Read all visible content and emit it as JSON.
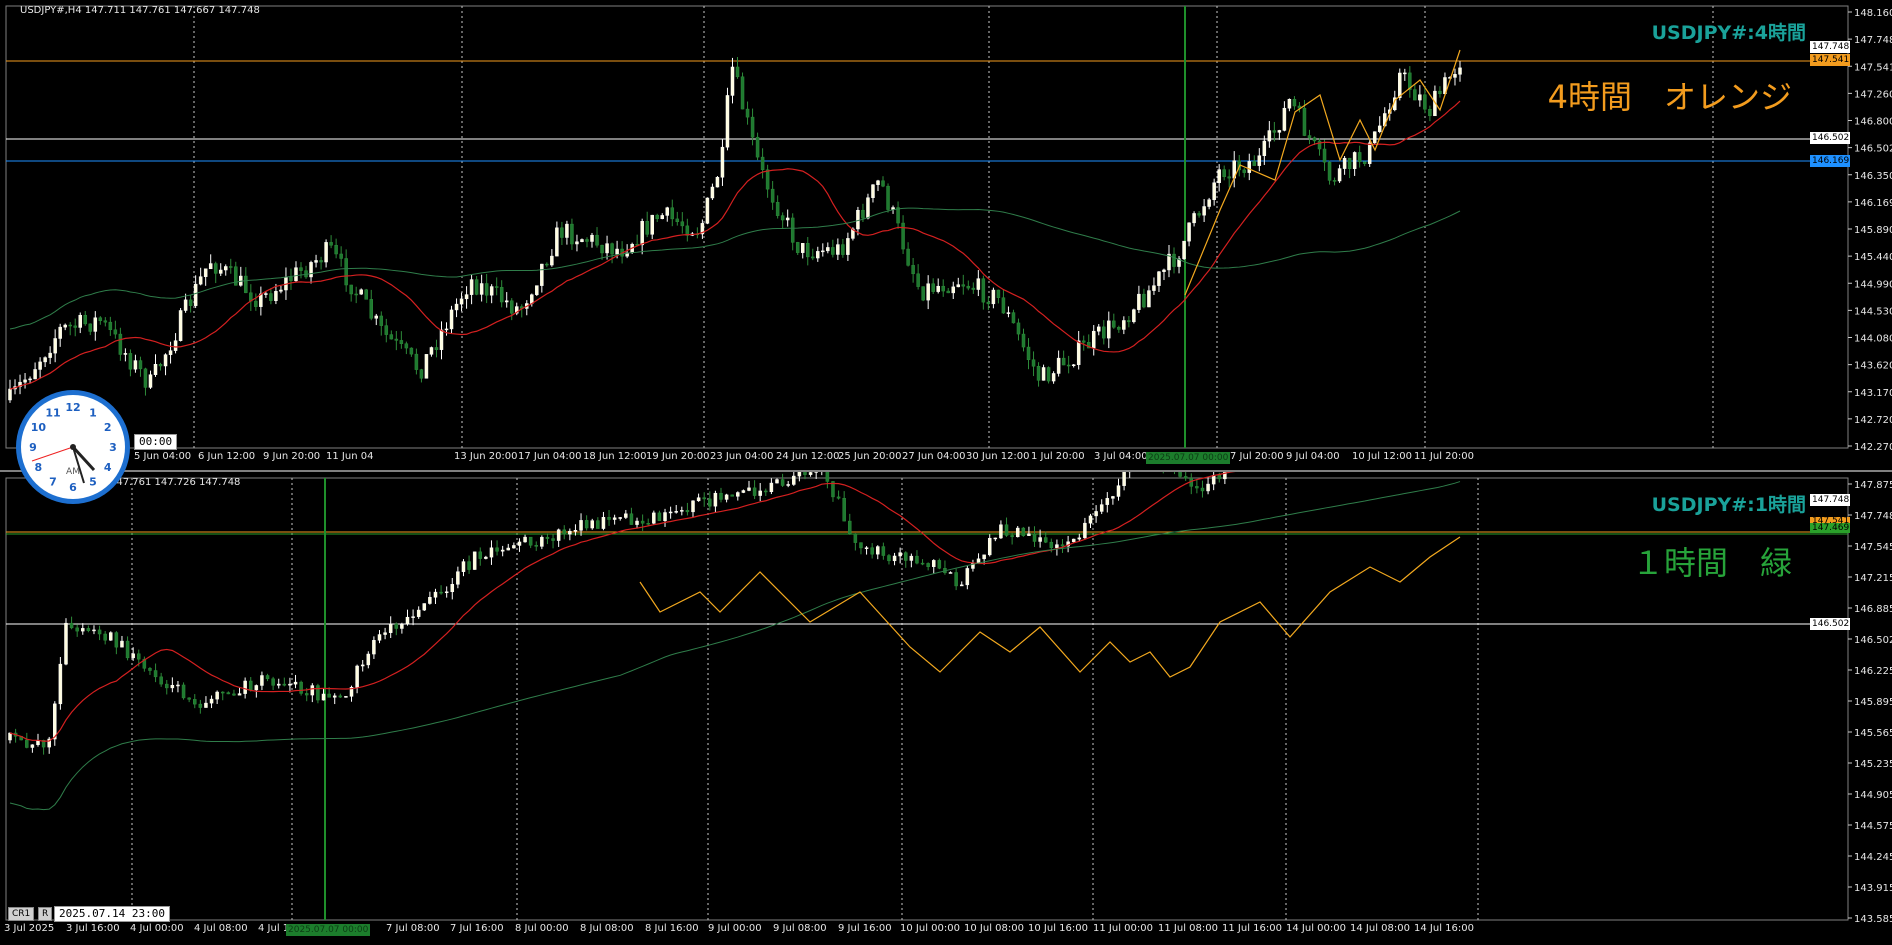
{
  "top": {
    "ohlc": "USDJPY#,H4  147.711 147.761 147.667 147.748",
    "symbol_label": "USDJPY#:4時間",
    "big_label": "4時間　オレンジ",
    "big_label_color": "#f39c1e",
    "price_ticks": [
      "148.160",
      "147.748",
      "147.541",
      "147.260",
      "146.800",
      "146.502",
      "146.350",
      "146.169",
      "145.890",
      "145.440",
      "144.990",
      "144.530",
      "144.080",
      "143.620",
      "143.170",
      "142.720",
      "142.270"
    ],
    "time_ticks": [
      "5 Jun 04:00",
      "6 Jun 12:00",
      "9 Jun 20:00",
      "11 Jun 04",
      "13 Jun 20:00",
      "17 Jun 04:00",
      "18 Jun 12:00",
      "19 Jun 20:00",
      "23 Jun 04:00",
      "24 Jun 12:00",
      "25 Jun 20:00",
      "27 Jun 04:00",
      "30 Jun 12:00",
      "1 Jul 20:00",
      "3 Jul 04:00",
      "7 Jul 20:00",
      "9 Jul 04:00",
      "10 Jul 12:00",
      "11 Jul 20:00"
    ],
    "vline_label": "2025.07.07 00:00",
    "stamp": "00:00",
    "tag_current": "147.748",
    "tag_orange": "147.541",
    "tag_white": "146.502",
    "tag_blue": "146.169"
  },
  "bottom": {
    "ohlc": "147.761 147.726 147.748",
    "symbol_label": "USDJPY#:1時間",
    "big_label": "１時間　緑",
    "big_label_color": "#27a33a",
    "price_ticks": [
      "147.875",
      "147.748",
      "147.545",
      "147.215",
      "146.885",
      "146.502",
      "146.225",
      "145.895",
      "145.565",
      "145.235",
      "144.905",
      "144.575",
      "144.245",
      "143.915",
      "143.585"
    ],
    "time_ticks": [
      "3 Jul 2025",
      "3 Jul 16:00",
      "4 Jul 00:00",
      "4 Jul 08:00",
      "4 Jul 16:00",
      "7 Jul 08:00",
      "7 Jul 16:00",
      "8 Jul 00:00",
      "8 Jul 08:00",
      "8 Jul 16:00",
      "9 Jul 00:00",
      "9 Jul 08:00",
      "9 Jul 16:00",
      "10 Jul 00:00",
      "10 Jul 08:00",
      "10 Jul 16:00",
      "11 Jul 00:00",
      "11 Jul 08:00",
      "11 Jul 16:00",
      "14 Jul 00:00",
      "14 Jul 08:00",
      "14 Jul 16:00"
    ],
    "vline_label": "2025.07.07 00:00",
    "stamp": "2025.07.14 23:00",
    "tag_current": "147.748",
    "tag_orange": "147.541",
    "tag_green": "147.469",
    "tag_white": "146.502",
    "cr": "CR1",
    "r": "R"
  },
  "clock": {
    "label": "AM",
    "numbers": [
      "12",
      "1",
      "2",
      "3",
      "4",
      "5",
      "6",
      "7",
      "8",
      "9",
      "10",
      "11"
    ]
  }
}
